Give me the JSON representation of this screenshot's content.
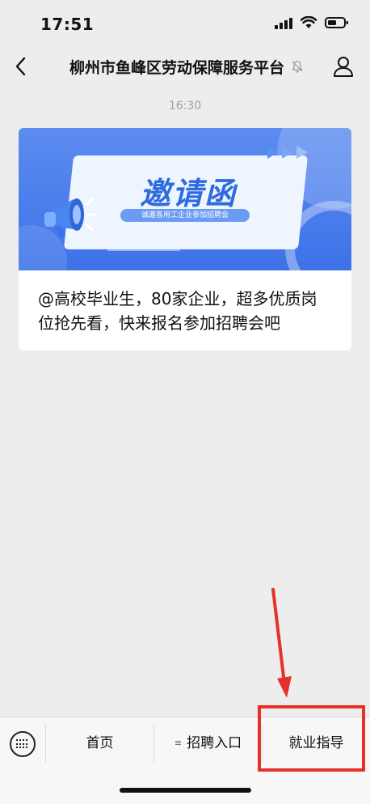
{
  "status_bar": {
    "time": "17:51",
    "icons": [
      "signal-icon",
      "wifi-icon",
      "battery-icon"
    ]
  },
  "nav": {
    "title": "柳州市鱼峰区劳动保障服务平台",
    "icons": [
      "back-icon",
      "mute-bell-icon",
      "profile-icon"
    ]
  },
  "chat": {
    "timestamp": "16:30",
    "card": {
      "banner_heading": "邀请函",
      "banner_subtitle": "诚邀各用工企业参加招聘会",
      "text": "@高校毕业生，80家企业，超多优质岗位抢先看，快来报名参加招聘会吧"
    }
  },
  "menu": {
    "items": [
      {
        "label": "首页"
      },
      {
        "label": "招聘入口",
        "prefix": "≡"
      },
      {
        "label": "就业指导"
      }
    ]
  },
  "colors": {
    "background": "#ededed",
    "banner_blue": "#3d72e8",
    "highlight_red": "#e8302a"
  }
}
